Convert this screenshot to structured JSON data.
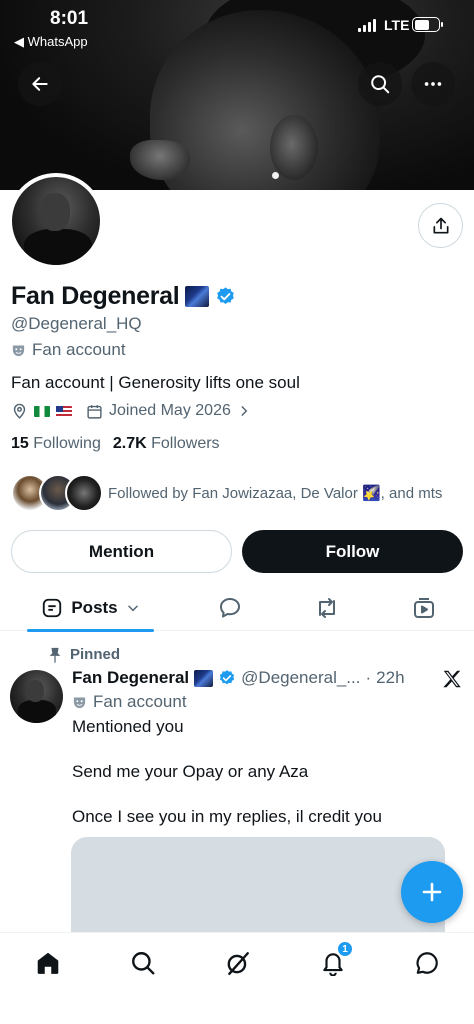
{
  "status_bar": {
    "time": "8:01",
    "back_app": "◀ WhatsApp",
    "network": "LTE"
  },
  "profile": {
    "display_name": "Fan Degeneral",
    "handle": "@Degeneral_HQ",
    "account_type": "Fan account",
    "bio": "Fan account | Generosity lifts one soul",
    "joined": "Joined May 2026",
    "following_count": "15",
    "following_label": "Following",
    "followers_count": "2.7K",
    "followers_label": "Followers",
    "followed_by": "Followed by Fan Jowizazaa, De Valor 🌠, and mts"
  },
  "buttons": {
    "mention": "Mention",
    "follow": "Follow"
  },
  "tabs": {
    "posts": "Posts"
  },
  "pinned_post": {
    "pinned_label": "Pinned",
    "author_name": "Fan Degeneral",
    "author_handle": "@Degeneral_...",
    "separator": "·",
    "time_ago": "22h",
    "account_type": "Fan account",
    "lines": [
      "Mentioned you",
      "Send me your Opay or any Aza",
      "Once I see you in my replies, il credit you"
    ]
  },
  "bottom_nav": {
    "notification_count": "1"
  },
  "icons": {
    "back": "arrow-left-icon",
    "search": "search-icon",
    "more": "more-horizontal-icon",
    "share": "share-icon",
    "verified": "verified-badge-icon",
    "location": "location-pin-icon",
    "calendar": "calendar-icon",
    "replies_tab": "speech-bubble-icon",
    "reposts_tab": "repost-icon",
    "media_tab": "media-icon",
    "compose": "plus-icon"
  },
  "colors": {
    "accent": "#1d9bf0",
    "text": "#0f1419",
    "secondary_text": "#536471",
    "follow_button": "#0f1419"
  }
}
